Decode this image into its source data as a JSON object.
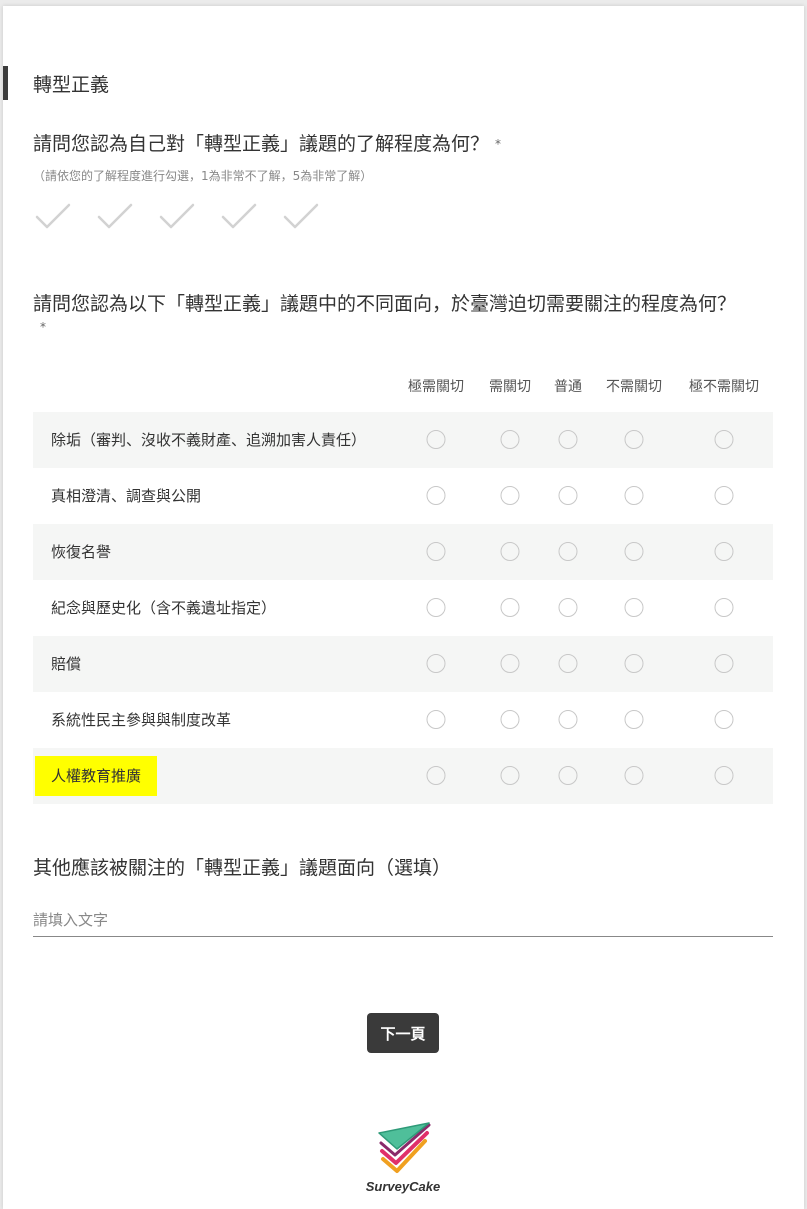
{
  "section": {
    "title": "轉型正義"
  },
  "q1": {
    "title": "請問您認為自己對「轉型正義」議題的了解程度為何？",
    "required_mark": "*",
    "hint": "（請依您的了解程度進行勾選，1為非常不了解，5為非常了解）",
    "scale_count": 5
  },
  "q2": {
    "title": "請問您認為以下「轉型正義」議題中的不同面向，於臺灣迫切需要關注的程度為何？",
    "required_mark": "*",
    "columns": [
      "極需關切",
      "需關切",
      "普通",
      "不需關切",
      "極不需關切"
    ],
    "rows": [
      "除垢（審判、沒收不義財產、追溯加害人責任）",
      "真相澄清、調查與公開",
      "恢復名譽",
      "紀念與歷史化（含不義遺址指定）",
      "賠償",
      "系統性民主參與與制度改革",
      "人權教育推廣"
    ]
  },
  "q3": {
    "title": "其他應該被關注的「轉型正義」議題面向（選填）",
    "placeholder": "請填入文字"
  },
  "next_button": {
    "label": "下一頁"
  },
  "brand": {
    "name": "SurveyCake"
  },
  "colors": {
    "highlight": "#ffff00",
    "button_bg": "#3a3a3a",
    "row_shade": "#f5f6f5"
  }
}
